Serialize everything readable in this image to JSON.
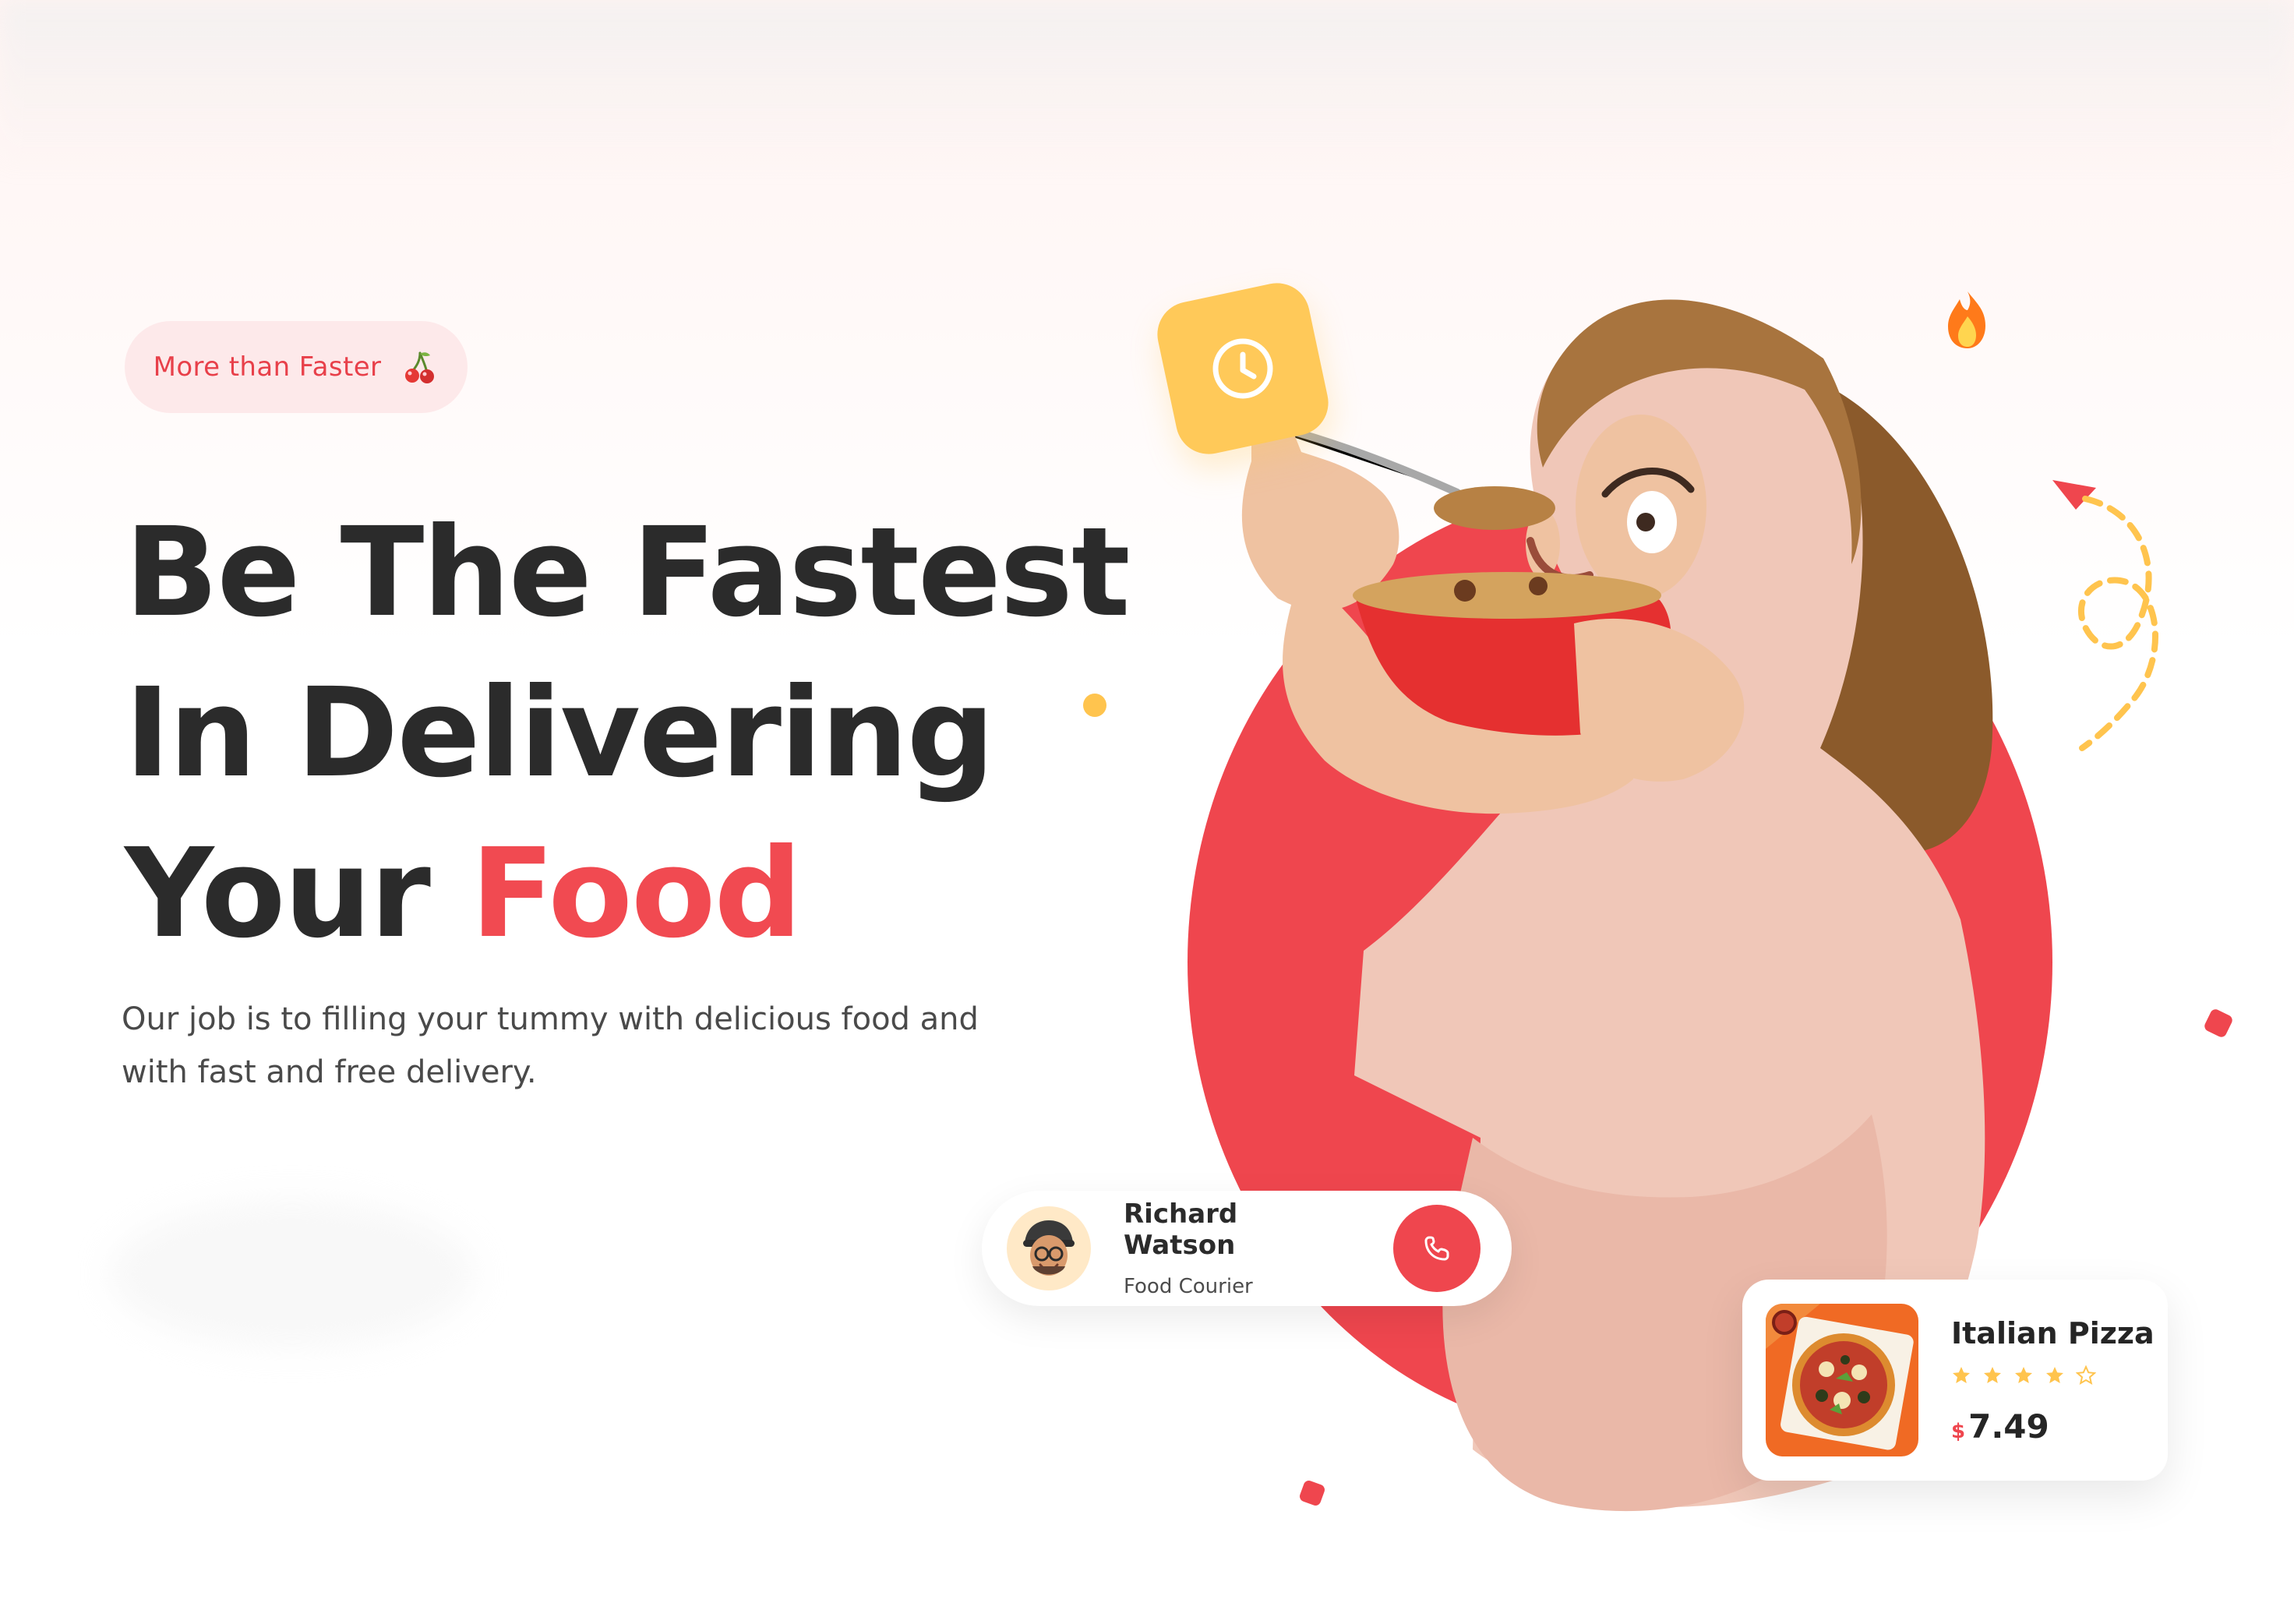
{
  "badge": {
    "label": "More than Faster",
    "icon": "cherry-icon"
  },
  "hero": {
    "line1": "Be The Fastest",
    "line2": "In Delivering",
    "line3_prefix": "Your",
    "line3_accent": "Food",
    "subtext": "Our job is to filling your tummy with delicious food and with fast and free delivery."
  },
  "decor": {
    "clock_icon": "clock-icon",
    "fire_icon": "fire-icon",
    "route_icon": "route-arrow-icon"
  },
  "courier": {
    "name": "Richard Watson",
    "role": "Food Courier",
    "call_icon": "phone-icon"
  },
  "product": {
    "name": "Italian Pizza",
    "rating": 4,
    "rating_max": 5,
    "currency": "$",
    "price": "7.49"
  },
  "colors": {
    "accent_red": "#ef464e",
    "headline": "#2b2b2b",
    "badge_bg": "#fde9ea",
    "clock_yellow": "#ffc959"
  }
}
